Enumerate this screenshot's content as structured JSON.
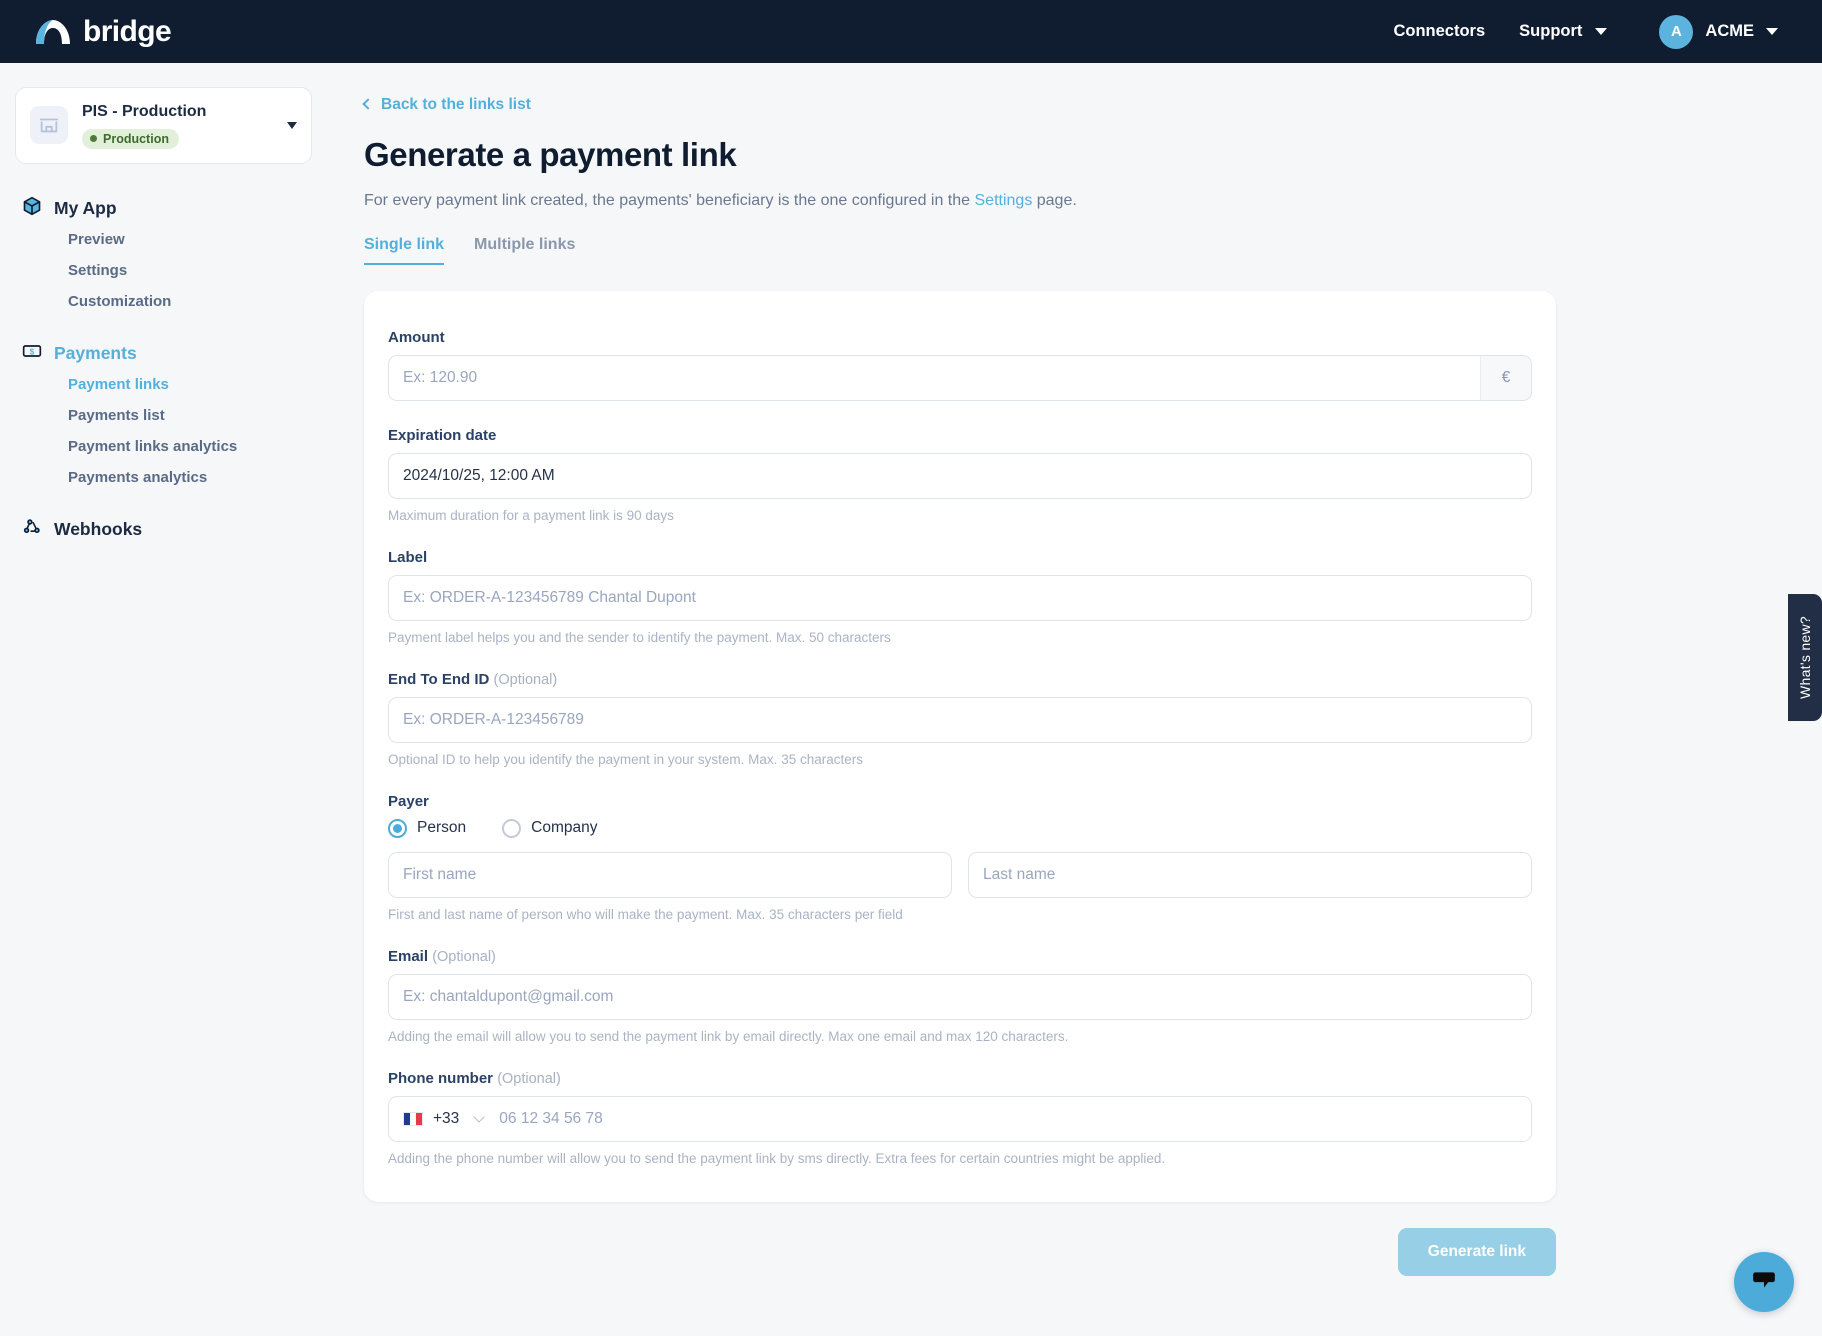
{
  "topbar": {
    "logo_text": "bridge",
    "connectors_label": "Connectors",
    "support_label": "Support",
    "avatar_initial": "A",
    "org_name": "ACME"
  },
  "sidebar": {
    "project": {
      "name": "PIS - Production",
      "environment": "Production"
    },
    "groups": [
      {
        "label": "My App",
        "active": false,
        "items": [
          {
            "label": "Preview",
            "active": false
          },
          {
            "label": "Settings",
            "active": false
          },
          {
            "label": "Customization",
            "active": false
          }
        ]
      },
      {
        "label": "Payments",
        "active": true,
        "items": [
          {
            "label": "Payment links",
            "active": true
          },
          {
            "label": "Payments list",
            "active": false
          },
          {
            "label": "Payment links analytics",
            "active": false
          },
          {
            "label": "Payments analytics",
            "active": false
          }
        ]
      },
      {
        "label": "Webhooks",
        "active": false,
        "items": []
      }
    ]
  },
  "main": {
    "back_link": "Back to the links list",
    "title": "Generate a payment link",
    "subtitle_before": "For every payment link created, the payments' beneficiary is the one configured in the ",
    "subtitle_link": "Settings",
    "subtitle_after": " page.",
    "tabs": [
      {
        "label": "Single link",
        "active": true
      },
      {
        "label": "Multiple links",
        "active": false
      }
    ],
    "form": {
      "amount": {
        "label": "Amount",
        "placeholder": "Ex: 120.90",
        "value": "",
        "currency_suffix": "€"
      },
      "expiration": {
        "label": "Expiration date",
        "value": "2024/10/25, 12:00 AM",
        "hint": "Maximum duration for a payment link is 90 days"
      },
      "label_field": {
        "label": "Label",
        "placeholder": "Ex: ORDER-A-123456789 Chantal Dupont",
        "value": "",
        "hint": "Payment label helps you and the sender to identify the payment. Max. 50 characters"
      },
      "end_to_end_id": {
        "label": "End To End ID",
        "optional": "(Optional)",
        "placeholder": "Ex: ORDER-A-123456789",
        "value": "",
        "hint": "Optional ID to help you identify the payment in your system. Max. 35 characters"
      },
      "payer": {
        "label": "Payer",
        "options": [
          {
            "label": "Person",
            "selected": true
          },
          {
            "label": "Company",
            "selected": false
          }
        ],
        "first_name_placeholder": "First name",
        "first_name_value": "",
        "last_name_placeholder": "Last name",
        "last_name_value": "",
        "hint": "First and last name of person who will make the payment. Max. 35 characters per field"
      },
      "email": {
        "label": "Email",
        "optional": "(Optional)",
        "placeholder": "Ex: chantaldupont@gmail.com",
        "value": "",
        "hint": "Adding the email will allow you to send the payment link by email directly. Max one email and max 120 characters."
      },
      "phone": {
        "label": "Phone number",
        "optional": "(Optional)",
        "country_code": "+33",
        "country_flag": "france-flag-icon",
        "placeholder": "06 12 34 56 78",
        "value": "",
        "hint": "Adding the phone number will allow you to send the payment link by sms directly. Extra fees for certain countries might be applied."
      }
    },
    "generate_button": "Generate link"
  },
  "floating": {
    "whats_new": "What's new?",
    "chat_icon": "chat-bubble-icon"
  },
  "colors": {
    "accent": "#54b0db",
    "dark": "#101d30",
    "page_bg": "#f6f7f9",
    "badge_green_bg": "#e2f0d9",
    "badge_green_text": "#3e6b2e"
  }
}
